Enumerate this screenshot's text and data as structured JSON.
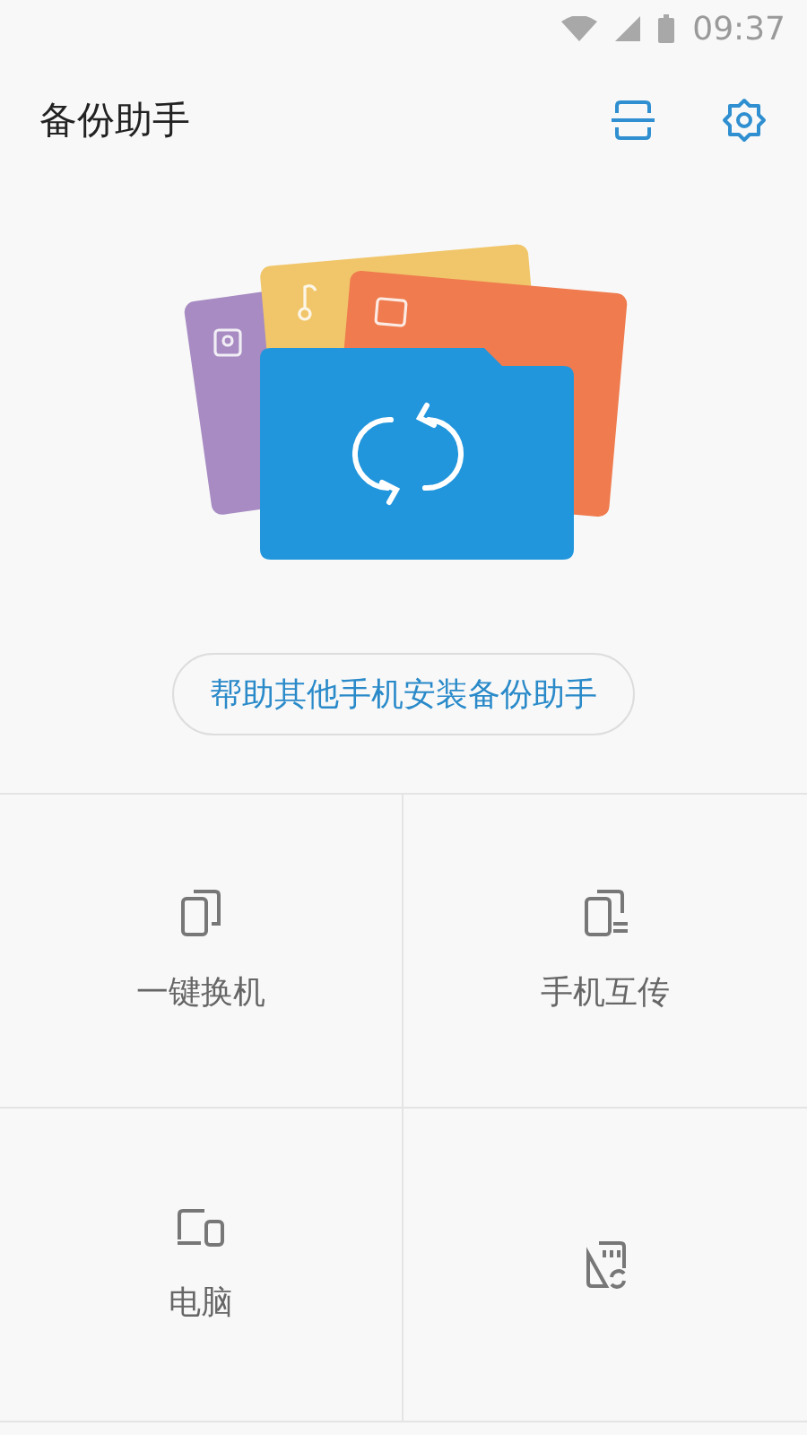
{
  "status_bar": {
    "time": "09:37"
  },
  "header": {
    "title": "备份助手"
  },
  "help_button": {
    "label": "帮助其他手机安装备份助手"
  },
  "tiles": [
    {
      "kind": "phones",
      "label": "一键换机"
    },
    {
      "kind": "transfer",
      "label": "手机互传"
    },
    {
      "kind": "computer",
      "label": "电脑"
    },
    {
      "kind": "sdcard"
    }
  ]
}
